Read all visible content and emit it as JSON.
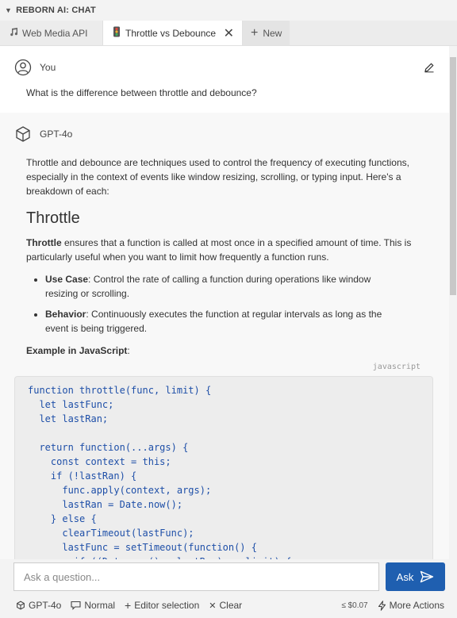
{
  "panel": {
    "title": "REBORN AI: CHAT"
  },
  "tabs": [
    {
      "label": "Web Media API",
      "icon": "music-icon"
    },
    {
      "label": "Throttle vs Debounce",
      "icon": "traffic-light-icon",
      "active": true
    }
  ],
  "new_tab_label": "New",
  "conversation": {
    "user": {
      "author": "You",
      "text": "What is the difference between throttle and debounce?"
    },
    "assistant": {
      "author": "GPT-4o",
      "intro": "Throttle and debounce are techniques used to control the frequency of executing functions, especially in the context of events like window resizing, scrolling, or typing input. Here's a breakdown of each:",
      "section_title": "Throttle",
      "throttle_term": "Throttle",
      "throttle_desc": " ensures that a function is called at most once in a specified amount of time. This is particularly useful when you want to limit how frequently a function runs.",
      "bullets": [
        {
          "term": "Use Case",
          "text": ": Control the rate of calling a function during operations like window resizing or scrolling."
        },
        {
          "term": "Behavior",
          "text": ": Continuously executes the function at regular intervals as long as the event is being triggered."
        }
      ],
      "example_label": "Example in JavaScript",
      "example_colon": ":",
      "code_language": "javascript",
      "code": "function throttle(func, limit) {\n  let lastFunc;\n  let lastRan;\n\n  return function(...args) {\n    const context = this;\n    if (!lastRan) {\n      func.apply(context, args);\n      lastRan = Date.now();\n    } else {\n      clearTimeout(lastFunc);\n      lastFunc = setTimeout(function() {\n        if ((Date.now() - lastRan) >= limit) {"
    }
  },
  "input": {
    "placeholder": "Ask a question...",
    "value": ""
  },
  "ask_button_label": "Ask",
  "bottom_bar": {
    "model": "GPT-4o",
    "mode": "Normal",
    "editor_selection": "Editor selection",
    "clear": "Clear",
    "cost": "≤ $0.07",
    "more_actions": "More Actions"
  },
  "colors": {
    "accent": "#1f5fb0",
    "code_text": "#1e4fa8"
  }
}
